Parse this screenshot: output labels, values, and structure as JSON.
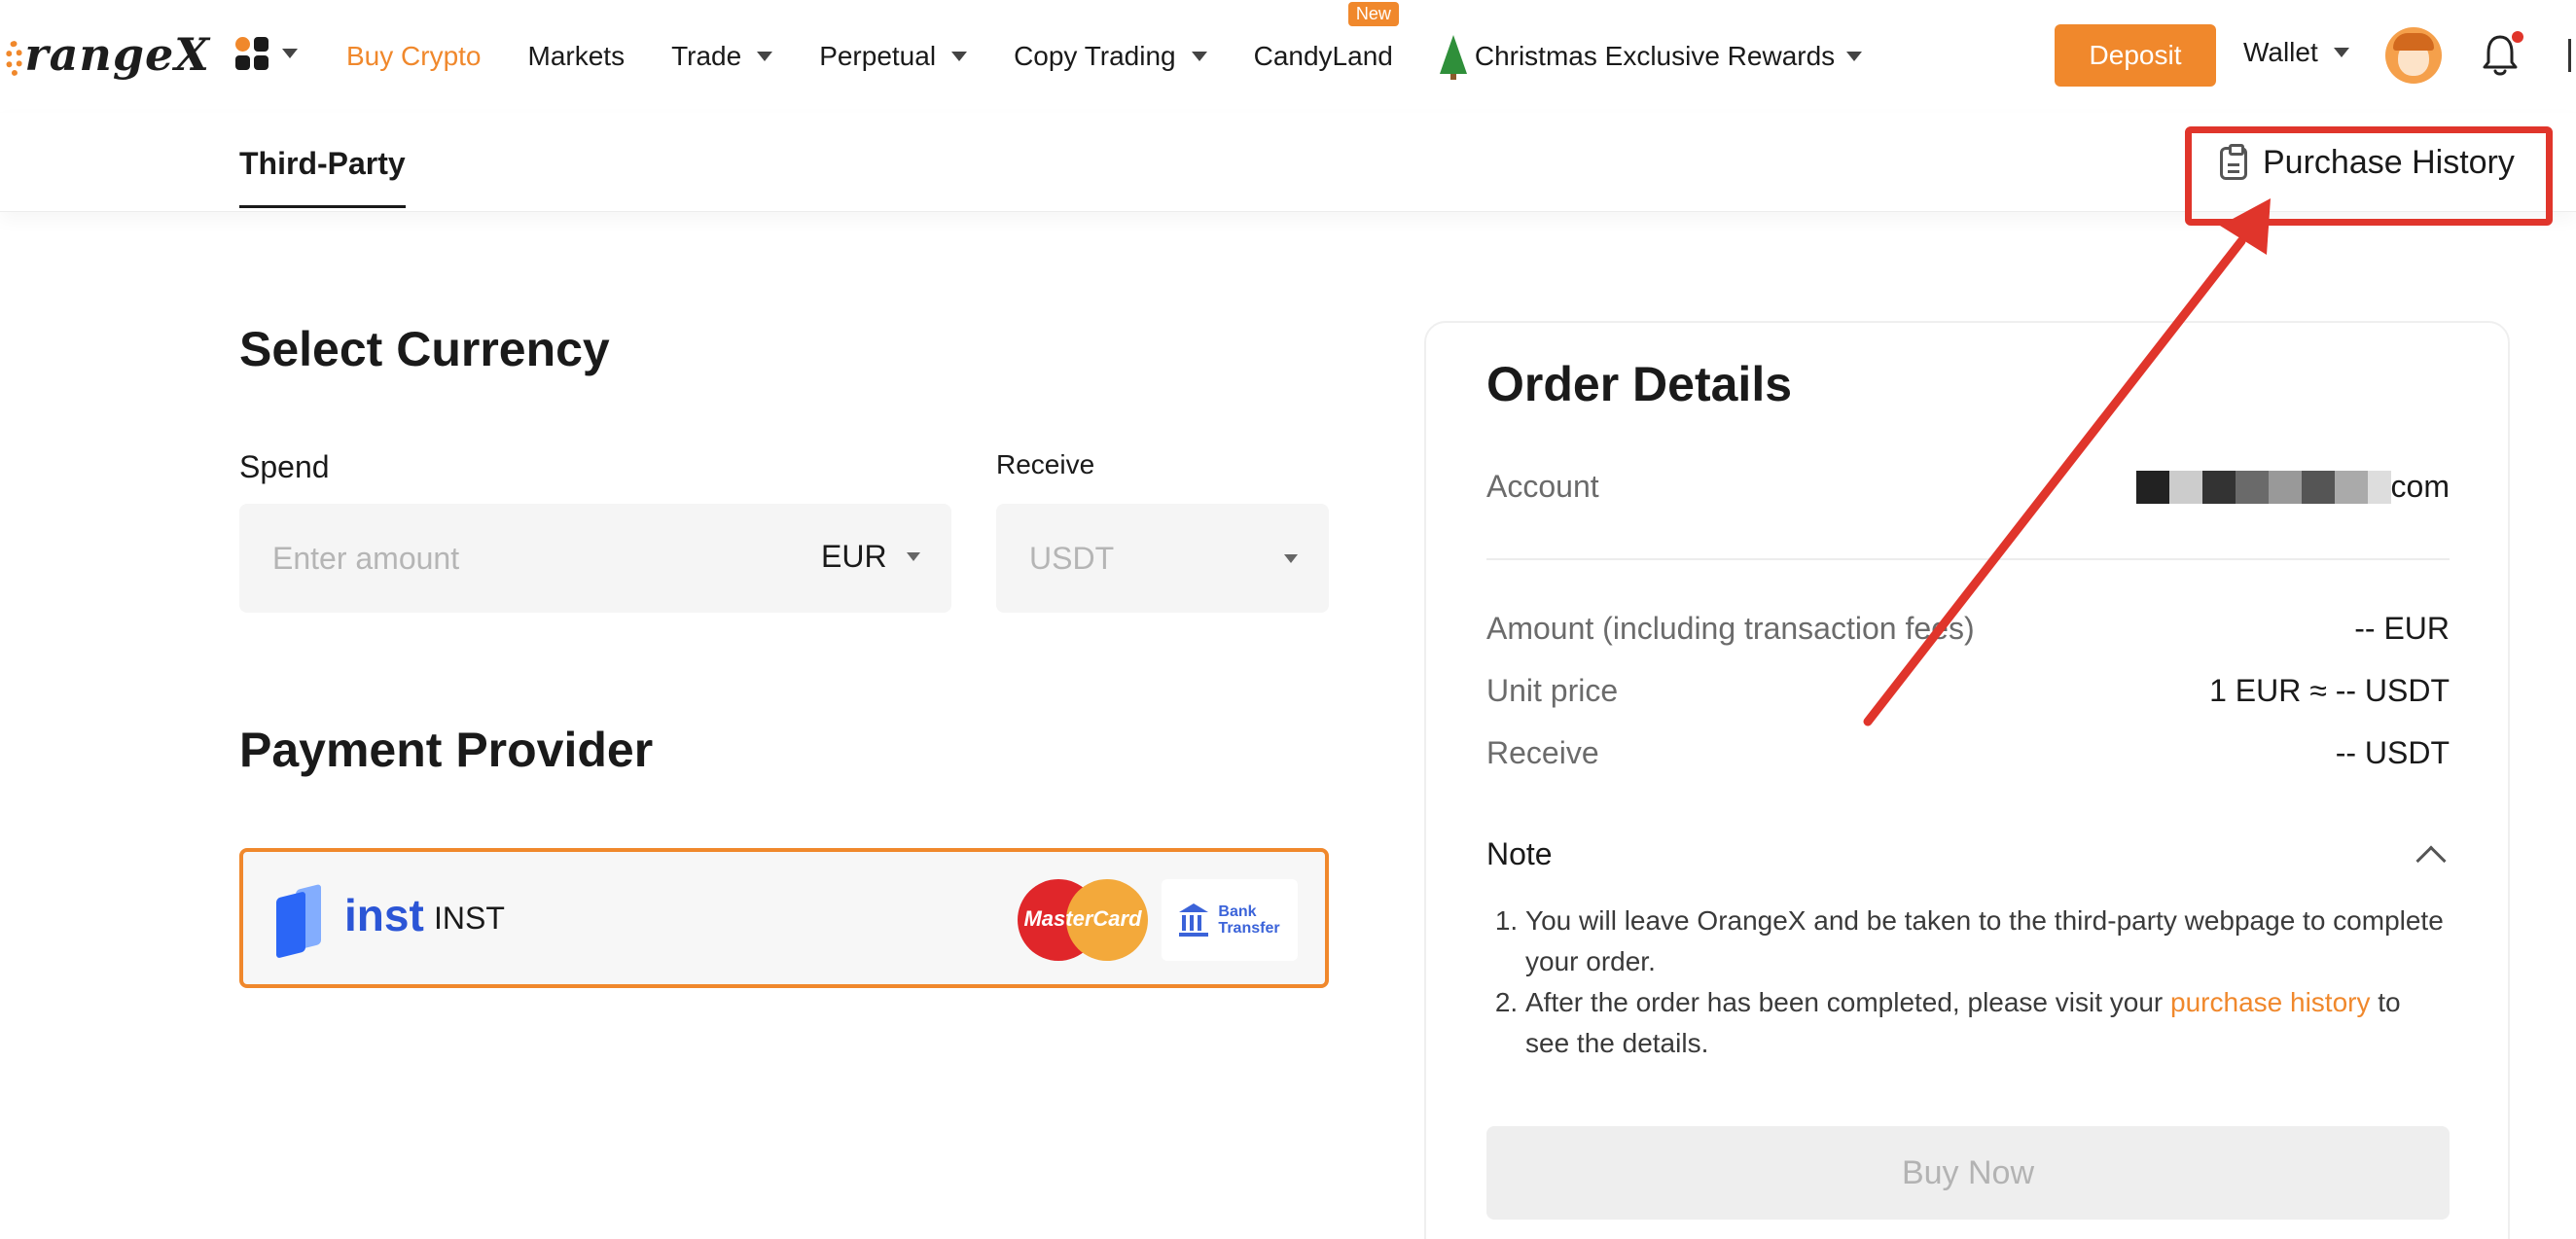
{
  "brand": {
    "logo_text": "rangeX",
    "accent": "#f0882c",
    "alert": "#e0352b"
  },
  "nav": {
    "items": [
      {
        "label": "Buy Crypto",
        "active": true,
        "dropdown": false
      },
      {
        "label": "Markets",
        "active": false,
        "dropdown": false
      },
      {
        "label": "Trade",
        "active": false,
        "dropdown": true
      },
      {
        "label": "Perpetual",
        "active": false,
        "dropdown": true
      },
      {
        "label": "Copy Trading",
        "active": false,
        "dropdown": true
      },
      {
        "label": "CandyLand",
        "active": false,
        "dropdown": false,
        "badge": "New"
      },
      {
        "label": "Christmas Exclusive Rewards",
        "active": false,
        "dropdown": true
      }
    ],
    "deposit_label": "Deposit",
    "wallet_label": "Wallet"
  },
  "subheader": {
    "tab": "Third-Party",
    "purchase_history": "Purchase History"
  },
  "select_currency": {
    "title": "Select Currency",
    "spend_label": "Spend",
    "spend_placeholder": "Enter amount",
    "spend_currency": "EUR",
    "receive_label": "Receive",
    "receive_currency": "USDT"
  },
  "payment_provider": {
    "title": "Payment Provider",
    "provider_logo_word": "inst",
    "provider_name": "INST",
    "mastercard_text": "MasterCard",
    "bank_transfer_line1": "Bank",
    "bank_transfer_line2": "Transfer"
  },
  "order_details": {
    "title": "Order Details",
    "account_label": "Account",
    "account_suffix": "com",
    "amount_label": "Amount (including transaction fees)",
    "amount_value": "-- EUR",
    "unit_price_label": "Unit price",
    "unit_price_value": "1 EUR ≈ -- USDT",
    "receive_label": "Receive",
    "receive_value": "-- USDT",
    "note_label": "Note",
    "note_1": "You will leave OrangeX and be taken to the third-party webpage to complete your order.",
    "note_2_before": "After the order has been completed, please visit your ",
    "note_2_link": "purchase history",
    "note_2_after": " to see the details.",
    "buy_now": "Buy Now"
  }
}
